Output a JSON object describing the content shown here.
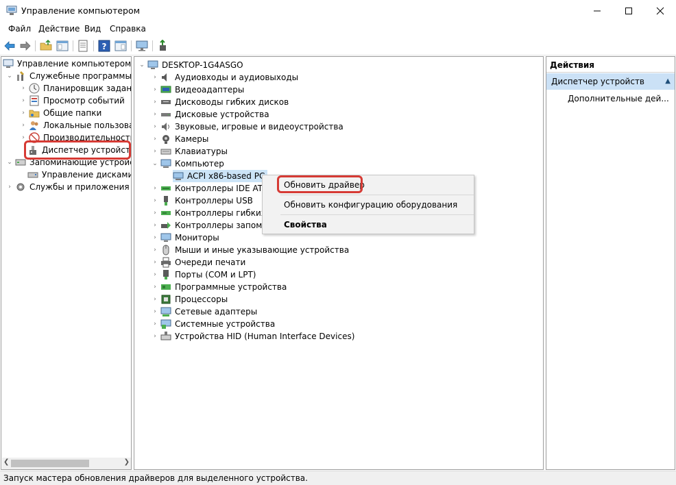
{
  "window": {
    "title": "Управление компьютером",
    "icon": "computer-management-icon",
    "controls": [
      "minimize",
      "maximize",
      "close"
    ]
  },
  "menu": {
    "file": "Файл",
    "action": "Действие",
    "view": "Вид",
    "help": "Справка"
  },
  "toolbar": {
    "buttons": [
      "back-arrow-icon",
      "forward-arrow-icon",
      "folder-up-icon",
      "show-hide-tree-icon",
      "properties-icon",
      "help-icon",
      "show-action-pane-icon",
      "monitor-icon",
      "update-driver-icon"
    ]
  },
  "left_tree": {
    "root": "Управление компьютером (л",
    "items": [
      {
        "label": "Служебные программы",
        "icon": "tools-icon"
      },
      {
        "label": "Планировщик заданий",
        "icon": "clock-icon"
      },
      {
        "label": "Просмотр событий",
        "icon": "event-viewer-icon"
      },
      {
        "label": "Общие папки",
        "icon": "shared-folder-icon"
      },
      {
        "label": "Локальные пользовате",
        "icon": "users-icon"
      },
      {
        "label": "Производительность",
        "icon": "performance-icon"
      },
      {
        "label": "Диспетчер устройств",
        "icon": "device-manager-icon"
      },
      {
        "label": "Запоминающие устройст",
        "icon": "storage-icon"
      },
      {
        "label": "Управление дисками",
        "icon": "disk-icon"
      },
      {
        "label": "Службы и приложения",
        "icon": "services-icon"
      }
    ]
  },
  "device_tree": {
    "root": "DESKTOP-1G4ASGO",
    "items": [
      {
        "label": "Аудиовходы и аудиовыходы",
        "icon": "speaker-icon"
      },
      {
        "label": "Видеоадаптеры",
        "icon": "display-adapter-icon"
      },
      {
        "label": "Дисководы гибких дисков",
        "icon": "floppy-drive-icon"
      },
      {
        "label": "Дисковые устройства",
        "icon": "disk-drive-icon"
      },
      {
        "label": "Звуковые, игровые и видеоустройства",
        "icon": "sound-icon"
      },
      {
        "label": "Камеры",
        "icon": "camera-icon"
      },
      {
        "label": "Клавиатуры",
        "icon": "keyboard-icon"
      },
      {
        "label": "Компьютер",
        "icon": "computer-icon"
      },
      {
        "label": "ACPI x86-based PC",
        "icon": "pc-icon"
      },
      {
        "label": "Контроллеры IDE ATA",
        "icon": "ide-controller-icon"
      },
      {
        "label": "Контроллеры USB",
        "icon": "usb-icon"
      },
      {
        "label": "Контроллеры гибких д",
        "icon": "floppy-controller-icon"
      },
      {
        "label": "Контроллеры запоми",
        "icon": "storage-controller-icon"
      },
      {
        "label": "Мониторы",
        "icon": "monitor-icon"
      },
      {
        "label": "Мыши и иные указывающие устройства",
        "icon": "mouse-icon"
      },
      {
        "label": "Очереди печати",
        "icon": "printer-icon"
      },
      {
        "label": "Порты (COM и LPT)",
        "icon": "port-icon"
      },
      {
        "label": "Программные устройства",
        "icon": "software-device-icon"
      },
      {
        "label": "Процессоры",
        "icon": "processor-icon"
      },
      {
        "label": "Сетевые адаптеры",
        "icon": "network-adapter-icon"
      },
      {
        "label": "Системные устройства",
        "icon": "system-device-icon"
      },
      {
        "label": "Устройства HID (Human Interface Devices)",
        "icon": "hid-icon"
      }
    ]
  },
  "context_menu": {
    "update_driver": "Обновить драйвер",
    "scan_hardware": "Обновить конфигурацию оборудования",
    "properties": "Свойства"
  },
  "actions_pane": {
    "title": "Действия",
    "selected": "Диспетчер устройств",
    "more": "Дополнительные дей..."
  },
  "status": {
    "text": "Запуск мастера обновления драйверов для выделенного устройства."
  },
  "colors": {
    "highlight_box": "#d63a34",
    "selection": "#cbe1f6",
    "pane_border": "#9b9b9b"
  }
}
